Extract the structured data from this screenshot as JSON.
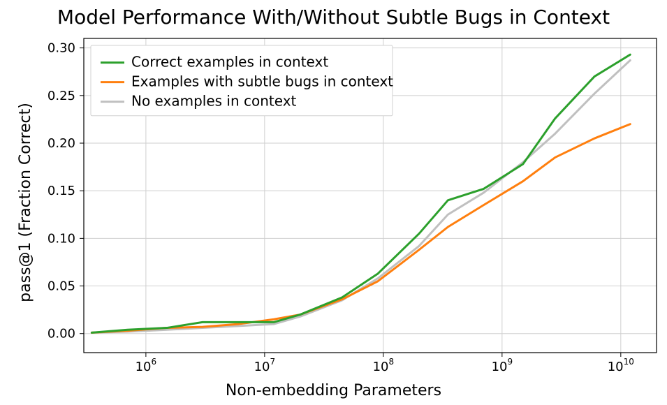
{
  "chart_data": {
    "type": "line",
    "title": "Model Performance With/Without Subtle Bugs in Context",
    "xlabel": "Non-embedding Parameters",
    "ylabel": "pass@1 (Fraction Correct)",
    "xscale": "log",
    "xlim": [
      300000,
      20000000000
    ],
    "ylim": [
      -0.02,
      0.31
    ],
    "x_ticks": [
      1000000,
      10000000,
      100000000,
      1000000000,
      10000000000
    ],
    "x_tick_labels": [
      "10^6",
      "10^7",
      "10^8",
      "10^9",
      "10^10"
    ],
    "y_ticks": [
      0.0,
      0.05,
      0.1,
      0.15,
      0.2,
      0.25,
      0.3
    ],
    "y_tick_labels": [
      "0.00",
      "0.05",
      "0.10",
      "0.15",
      "0.20",
      "0.25",
      "0.30"
    ],
    "x": [
      350000,
      700000,
      1500000,
      3000000,
      6000000,
      12000000,
      20000000,
      45000000,
      90000000,
      200000000,
      350000000,
      700000000,
      1500000000,
      2800000000,
      6000000000,
      12000000000
    ],
    "series": [
      {
        "name": "Correct examples in context",
        "color": "#2ca02c",
        "values": [
          0.001,
          0.004,
          0.006,
          0.012,
          0.012,
          0.012,
          0.02,
          0.038,
          0.063,
          0.105,
          0.14,
          0.152,
          0.178,
          0.226,
          0.27,
          0.293
        ]
      },
      {
        "name": "Examples with subtle bugs in context",
        "color": "#ff7f0e",
        "values": [
          0.001,
          0.003,
          0.006,
          0.007,
          0.01,
          0.015,
          0.02,
          0.036,
          0.055,
          0.088,
          0.112,
          0.135,
          0.16,
          0.185,
          0.205,
          0.22
        ]
      },
      {
        "name": "No examples in context",
        "color": "#c0c0c0",
        "values": [
          0.001,
          0.002,
          0.004,
          0.006,
          0.008,
          0.01,
          0.018,
          0.035,
          0.058,
          0.092,
          0.125,
          0.148,
          0.18,
          0.21,
          0.252,
          0.287
        ]
      }
    ],
    "legend_position": "upper-left",
    "grid": true
  }
}
